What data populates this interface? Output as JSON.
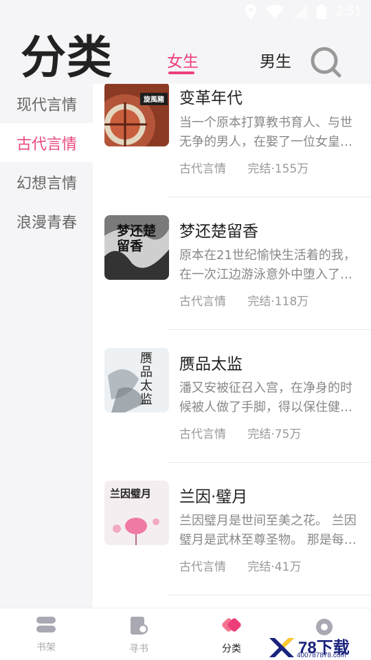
{
  "status_bar": {
    "time": "2:51"
  },
  "header": {
    "title": "分类",
    "tabs": [
      {
        "label": "女生",
        "active": true
      },
      {
        "label": "男生",
        "active": false
      }
    ]
  },
  "sidebar": {
    "items": [
      {
        "label": "现代言情",
        "active": false
      },
      {
        "label": "古代言情",
        "active": true
      },
      {
        "label": "幻想言情",
        "active": false
      },
      {
        "label": "浪漫青春",
        "active": false
      }
    ]
  },
  "books": [
    {
      "title": "变革年代",
      "desc": "当一个原本打算教书育人、与世无争的男人，在娶了一位女皇…",
      "category": "古代言情",
      "status": "完结·155万",
      "cover_text": "旋風豬"
    },
    {
      "title": "梦还楚留香",
      "desc": "原本在21世纪愉快生活着的我，在一次江边游泳意外中堕入了…",
      "category": "古代言情",
      "status": "完结·118万",
      "cover_text": "梦还楚留香"
    },
    {
      "title": "赝品太监",
      "desc": "潘又安被征召入宫，在净身的时候被人做了手脚，得以保住健…",
      "category": "古代言情",
      "status": "完结·75万",
      "cover_text": "赝品太监"
    },
    {
      "title": "兰因·璧月",
      "desc": "兰因璧月是世间至美之花。 兰因璧月是武林至尊圣物。 那是每…",
      "category": "古代言情",
      "status": "完结·41万",
      "cover_text": "兰因璧月"
    }
  ],
  "bottom_nav": [
    {
      "label": "书架",
      "icon": "bookshelf-icon",
      "active": false
    },
    {
      "label": "寻书",
      "icon": "find-book-icon",
      "active": false
    },
    {
      "label": "分类",
      "icon": "category-icon",
      "active": true
    },
    {
      "label": "",
      "icon": "profile-icon",
      "active": false
    }
  ],
  "watermark": {
    "brand": "78下载",
    "url": "400787878.com"
  },
  "colors": {
    "accent": "#ec3f7a",
    "sidebar_bg": "#f5f5f7"
  }
}
